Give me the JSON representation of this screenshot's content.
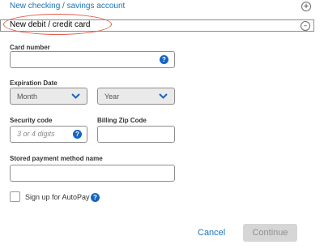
{
  "accordion": {
    "checking_label": "New checking / savings account",
    "checking_toggle": "+",
    "card_label": "New debit / credit card",
    "card_toggle": "–"
  },
  "form": {
    "card_number": {
      "label": "Card number",
      "value": "",
      "help": "?"
    },
    "expiration": {
      "label": "Expiration Date",
      "month": "Month",
      "year": "Year"
    },
    "security_code": {
      "label": "Security code",
      "placeholder": "3 or 4 digits",
      "help": "?"
    },
    "billing_zip": {
      "label": "Billing Zip Code",
      "value": ""
    },
    "stored_name": {
      "label": "Stored payment method name",
      "value": ""
    },
    "autopay": {
      "label": "Sign up for AutoPay",
      "checked": false,
      "help": "?"
    }
  },
  "actions": {
    "cancel": "Cancel",
    "continue": "Continue"
  },
  "colors": {
    "link": "#1a73b8",
    "help_icon": "#1565c0",
    "highlight_oval": "#e05a4a",
    "continue_disabled_bg": "#d6d6d6"
  }
}
